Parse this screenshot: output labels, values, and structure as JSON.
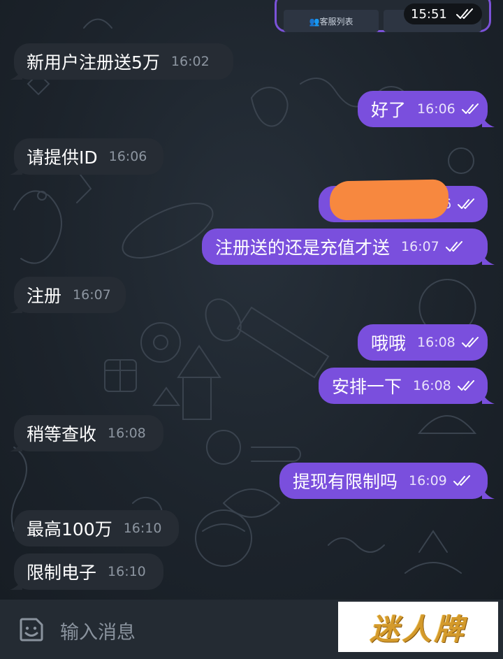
{
  "header_card": {
    "button_label": "👥客服列表",
    "time": "15:51"
  },
  "messages": [
    {
      "dir": "in",
      "text": "新用户注册送5万",
      "time": "16:02"
    },
    {
      "dir": "out",
      "text": "好了",
      "time": "16:06"
    },
    {
      "dir": "in",
      "text": "请提供ID",
      "time": "16:06"
    },
    {
      "dir": "out",
      "text": "",
      "time": "06",
      "redacted": true
    },
    {
      "dir": "out",
      "text": "注册送的还是充值才送",
      "time": "16:07"
    },
    {
      "dir": "in",
      "text": "注册",
      "time": "16:07"
    },
    {
      "dir": "out",
      "text": "哦哦",
      "time": "16:08"
    },
    {
      "dir": "out",
      "text": "安排一下",
      "time": "16:08"
    },
    {
      "dir": "in",
      "text": "稍等查收",
      "time": "16:08"
    },
    {
      "dir": "out",
      "text": "提现有限制吗",
      "time": "16:09"
    },
    {
      "dir": "in",
      "text": "最高100万",
      "time": "16:10"
    },
    {
      "dir": "in",
      "text": "限制电子",
      "time": "16:10"
    }
  ],
  "input": {
    "placeholder": "输入消息"
  },
  "watermark": {
    "text": "迷人牌"
  },
  "colors": {
    "outgoing_bubble": "#7a4fdd",
    "incoming_bubble": "#262c34",
    "background": "#1b2129"
  },
  "icons": {
    "emoji": "sticker-emoji-icon",
    "read_receipt": "double-check-icon"
  }
}
